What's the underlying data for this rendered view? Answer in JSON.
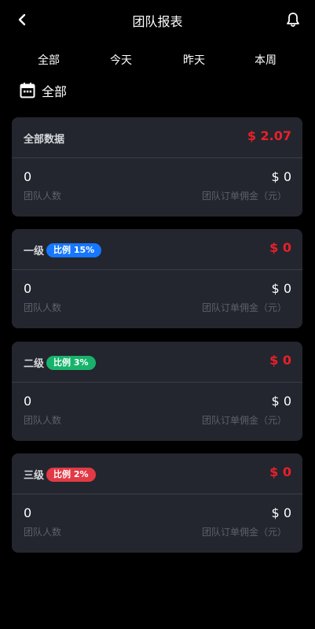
{
  "header": {
    "title": "团队报表",
    "back_icon": "chevron-left-icon",
    "bell_icon": "bell-icon"
  },
  "tabs": [
    {
      "label": "全部"
    },
    {
      "label": "今天"
    },
    {
      "label": "昨天"
    },
    {
      "label": "本周"
    }
  ],
  "date_filter": {
    "icon": "calendar-icon",
    "label": "全部"
  },
  "colors": {
    "background": "#000000",
    "card": "#23262e",
    "amount_red": "#e8202a",
    "badge_blue": "#1677ff",
    "badge_green": "#18b36b",
    "badge_red": "#e23a45",
    "muted_text": "#5c606a"
  },
  "cards": [
    {
      "level": "全部数据",
      "badge": "",
      "amount": "$ 2.07",
      "team_count": "0",
      "team_count_label": "团队人数",
      "commission": "$ 0",
      "commission_label": "团队订单佣金（元）"
    },
    {
      "level": "一级",
      "badge": "比例 15%",
      "amount": "$ 0",
      "team_count": "0",
      "team_count_label": "团队人数",
      "commission": "$ 0",
      "commission_label": "团队订单佣金（元）"
    },
    {
      "level": "二级",
      "badge": "比例 3%",
      "amount": "$ 0",
      "team_count": "0",
      "team_count_label": "团队人数",
      "commission": "$ 0",
      "commission_label": "团队订单佣金（元）"
    },
    {
      "level": "三级",
      "badge": "比例 2%",
      "amount": "$ 0",
      "team_count": "0",
      "team_count_label": "团队人数",
      "commission": "$ 0",
      "commission_label": "团队订单佣金（元）"
    }
  ]
}
